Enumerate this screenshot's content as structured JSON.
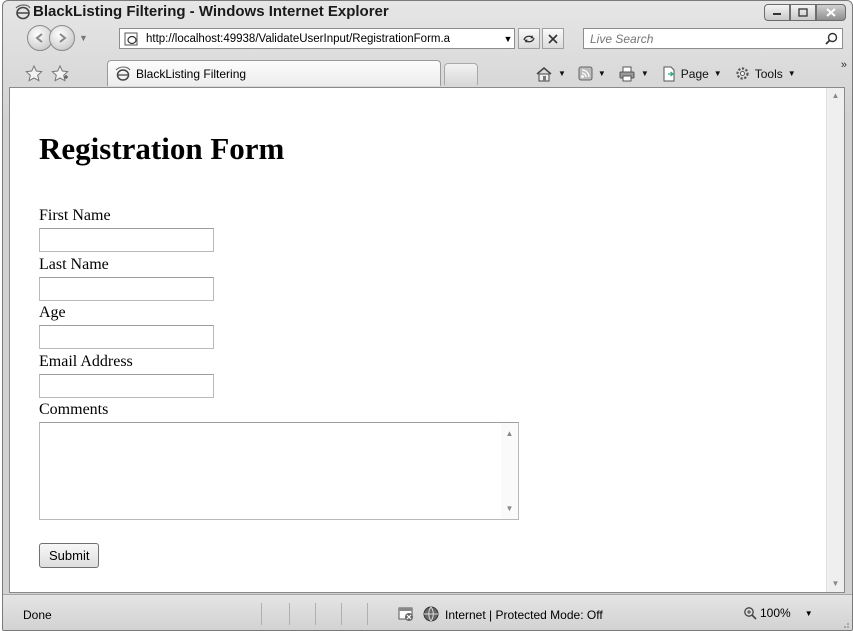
{
  "window": {
    "title": "BlackListing Filtering - Windows Internet Explorer"
  },
  "address_bar": {
    "url": "http://localhost:49938/ValidateUserInput/RegistrationForm.a"
  },
  "search": {
    "placeholder": "Live Search"
  },
  "tabs": [
    {
      "label": "BlackListing Filtering"
    }
  ],
  "command_bar": {
    "page_label": "Page",
    "tools_label": "Tools"
  },
  "page": {
    "heading": "Registration Form",
    "fields": {
      "first_name_label": "First Name",
      "last_name_label": "Last Name",
      "age_label": "Age",
      "email_label": "Email Address",
      "comments_label": "Comments"
    },
    "submit_label": "Submit"
  },
  "status_bar": {
    "status": "Done",
    "zone": "Internet | Protected Mode: Off",
    "zoom": "100%"
  },
  "icons": [
    "ie-logo-icon",
    "back-icon",
    "forward-icon",
    "refresh-icon",
    "stop-icon",
    "search-icon",
    "favorites-star-icon",
    "add-favorites-icon",
    "home-icon",
    "feeds-icon",
    "print-icon",
    "page-icon",
    "tools-gear-icon",
    "popup-blocked-icon",
    "internet-globe-icon",
    "zoom-magnifier-icon"
  ]
}
